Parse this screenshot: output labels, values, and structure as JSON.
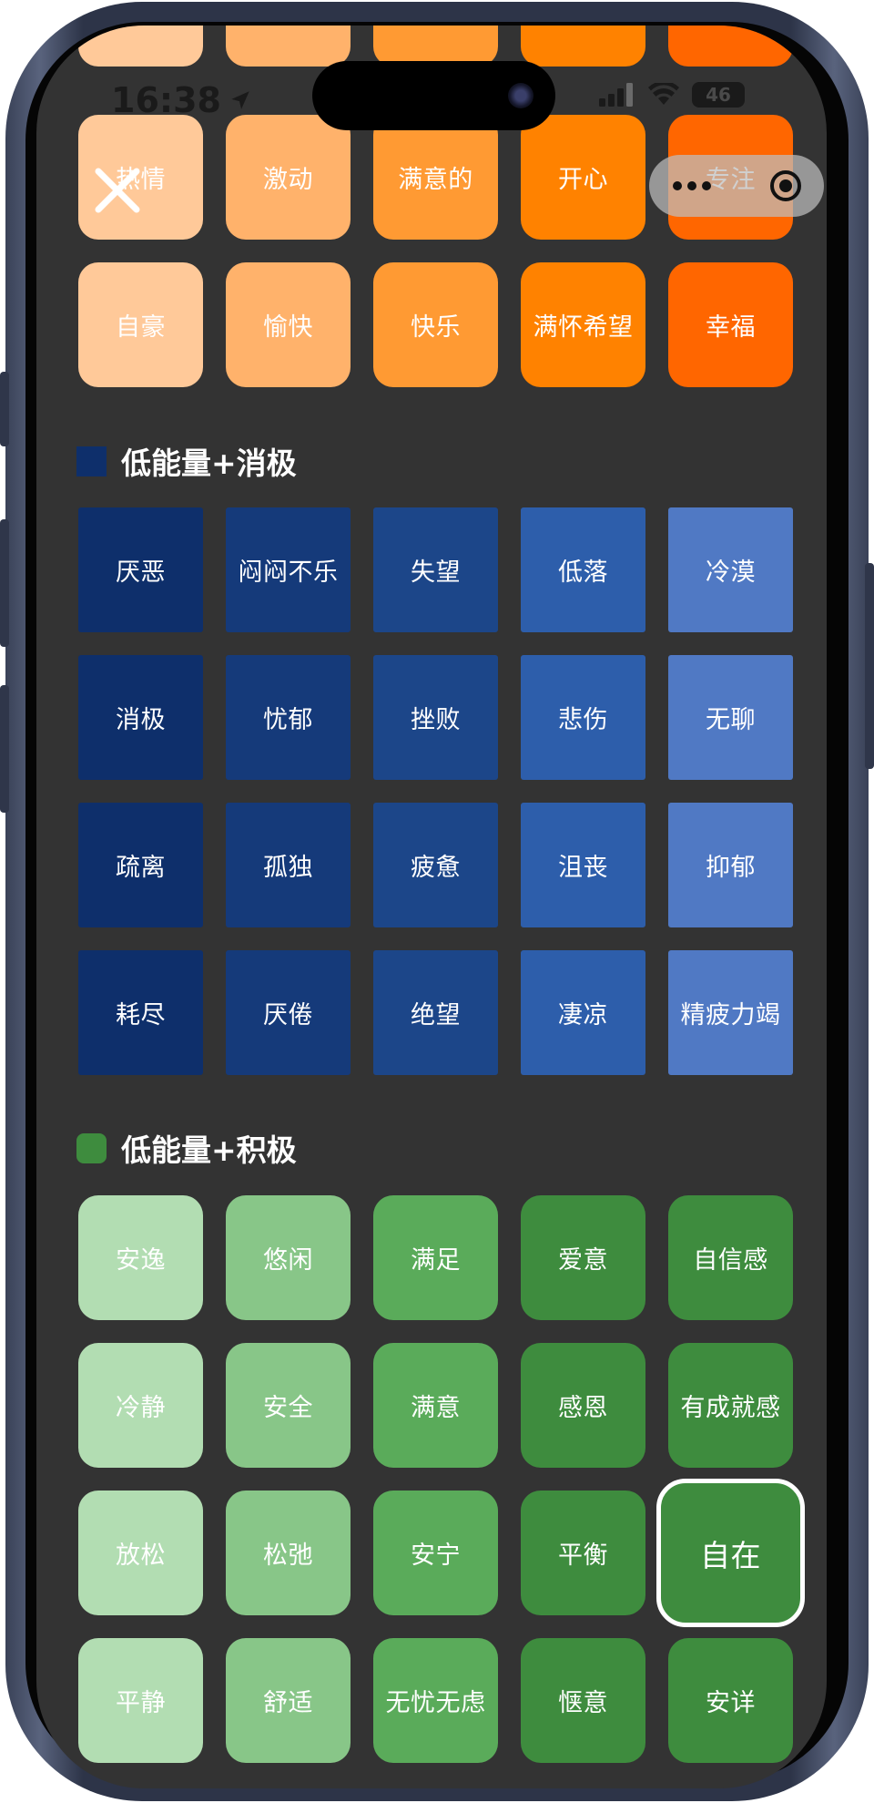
{
  "status_bar": {
    "time": "16:38",
    "battery": "46"
  },
  "sections": {
    "high_positive": {
      "color": "#ff8200",
      "rows": [
        [
          "",
          "",
          "",
          "",
          ""
        ],
        [
          "热情",
          "激动",
          "满意的",
          "开心",
          "专注"
        ],
        [
          "自豪",
          "愉快",
          "快乐",
          "满怀希望",
          "幸福"
        ]
      ]
    },
    "low_negative": {
      "title": "低能量+消极",
      "color": "#0e2f6b",
      "rows": [
        [
          "厌恶",
          "闷闷不乐",
          "失望",
          "低落",
          "冷漠"
        ],
        [
          "消极",
          "忧郁",
          "挫败",
          "悲伤",
          "无聊"
        ],
        [
          "疏离",
          "孤独",
          "疲惫",
          "沮丧",
          "抑郁"
        ],
        [
          "耗尽",
          "厌倦",
          "绝望",
          "凄凉",
          "精疲力竭"
        ]
      ]
    },
    "low_positive": {
      "title": "低能量+积极",
      "color": "#3e8c3e",
      "rows": [
        [
          "安逸",
          "悠闲",
          "满足",
          "爱意",
          "自信感"
        ],
        [
          "冷静",
          "安全",
          "满意",
          "感恩",
          "有成就感"
        ],
        [
          "放松",
          "松弛",
          "安宁",
          "平衡",
          "自在"
        ],
        [
          "平静",
          "舒适",
          "无忧无虑",
          "惬意",
          "安详"
        ]
      ],
      "selected": "自在"
    }
  }
}
